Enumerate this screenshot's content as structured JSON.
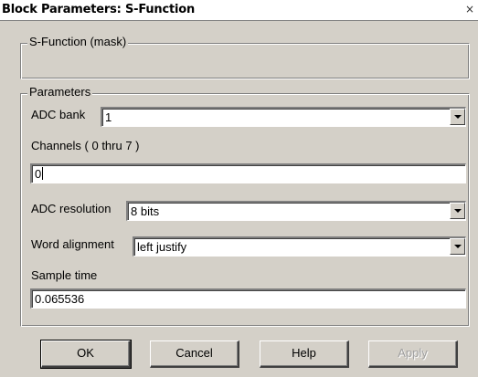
{
  "window": {
    "title": "Block Parameters: S-Function",
    "close_glyph": "×"
  },
  "mask_group": {
    "legend": "S-Function (mask)"
  },
  "params_group": {
    "legend": "Parameters"
  },
  "fields": {
    "adc_bank": {
      "label": "ADC bank",
      "value": "1"
    },
    "channels": {
      "label": "Channels ( 0 thru 7 )",
      "value": "0"
    },
    "adc_resolution": {
      "label": "ADC resolution",
      "value": "8 bits"
    },
    "word_alignment": {
      "label": "Word alignment",
      "value": "left justify"
    },
    "sample_time": {
      "label": "Sample time",
      "value": "0.065536"
    }
  },
  "buttons": {
    "ok": "OK",
    "cancel": "Cancel",
    "help": "Help",
    "apply": "Apply"
  },
  "icons": {
    "dropdown": "chevron-down-icon",
    "close": "close-icon"
  }
}
